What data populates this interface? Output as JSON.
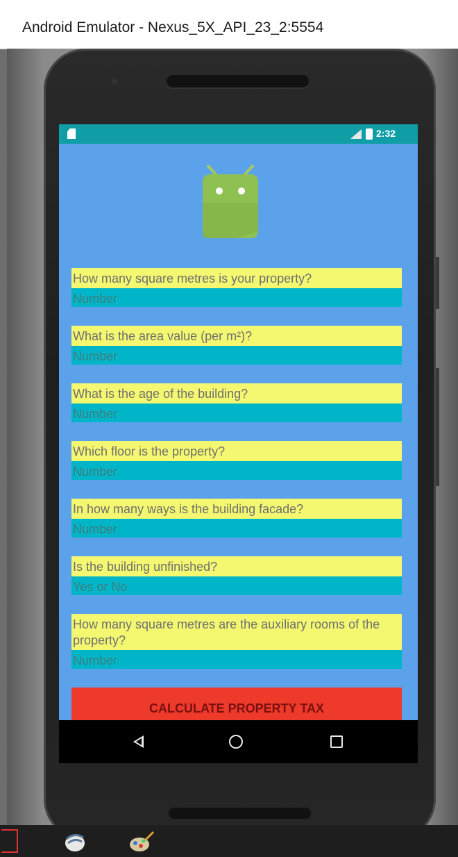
{
  "window": {
    "title": "Android Emulator - Nexus_5X_API_23_2:5554"
  },
  "status_bar": {
    "time": "2:32"
  },
  "form": {
    "fields": [
      {
        "question": "How many square metres is your property?",
        "answer_hint": "Number"
      },
      {
        "question": "What is the area value (per m²)?",
        "answer_hint": "Number"
      },
      {
        "question": "What is the age of the building?",
        "answer_hint": "Number"
      },
      {
        "question": "Which floor is the property?",
        "answer_hint": "Number"
      },
      {
        "question": "In how many ways is the building facade?",
        "answer_hint": "Number"
      },
      {
        "question": "Is the building unfinished?",
        "answer_hint": "Yes or No"
      },
      {
        "question": "How many square metres are the auxiliary rooms of the property?",
        "answer_hint": "Number"
      }
    ],
    "calculate_button": "CALCULATE PROPERTY TAX"
  },
  "colors": {
    "screen_background": "#5ca2ea",
    "question_background": "#f4f870",
    "answer_background": "#00b5c8",
    "button_background": "#ed3a2a",
    "status_bar": "#0f9ea6"
  }
}
